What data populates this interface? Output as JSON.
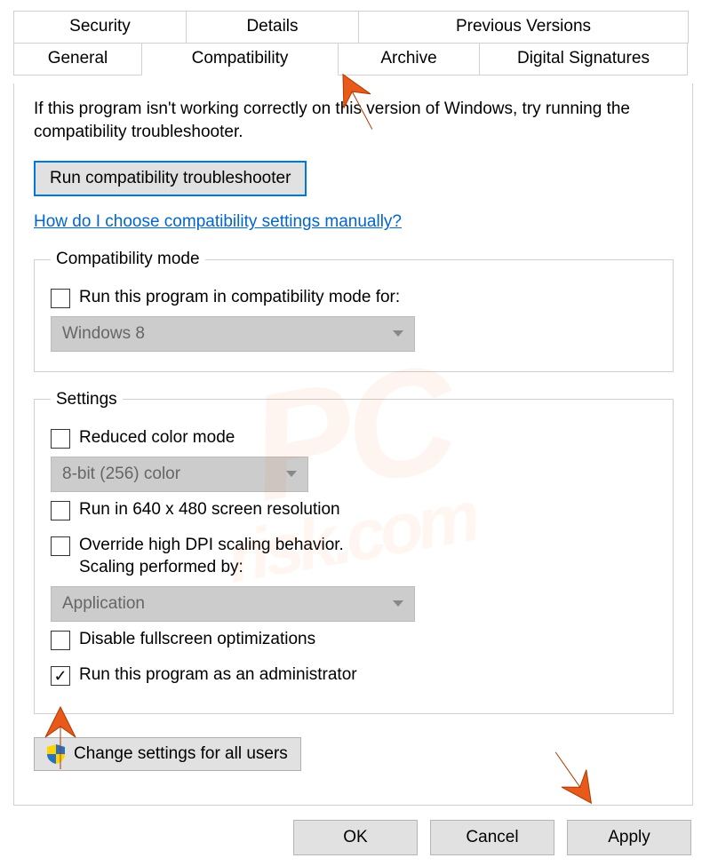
{
  "tabs": {
    "row1": [
      "Security",
      "Details",
      "Previous Versions"
    ],
    "row2": [
      "General",
      "Compatibility",
      "Archive",
      "Digital Signatures"
    ],
    "active": "Compatibility"
  },
  "intro": "If this program isn't working correctly on this version of Windows, try running the compatibility troubleshooter.",
  "run_troubleshooter": "Run compatibility troubleshooter",
  "help_link": "How do I choose compatibility settings manually?",
  "compat_mode": {
    "legend": "Compatibility mode",
    "checkbox": "Run this program in compatibility mode for:",
    "dropdown": "Windows 8"
  },
  "settings": {
    "legend": "Settings",
    "reduced_color": "Reduced color mode",
    "color_dropdown": "8-bit (256) color",
    "run_640": "Run in 640 x 480 screen resolution",
    "override_dpi": "Override high DPI scaling behavior.\nScaling performed by:",
    "dpi_dropdown": "Application",
    "disable_fullscreen": "Disable fullscreen optimizations",
    "run_admin": "Run this program as an administrator"
  },
  "change_all": "Change settings for all users",
  "buttons": {
    "ok": "OK",
    "cancel": "Cancel",
    "apply": "Apply"
  }
}
